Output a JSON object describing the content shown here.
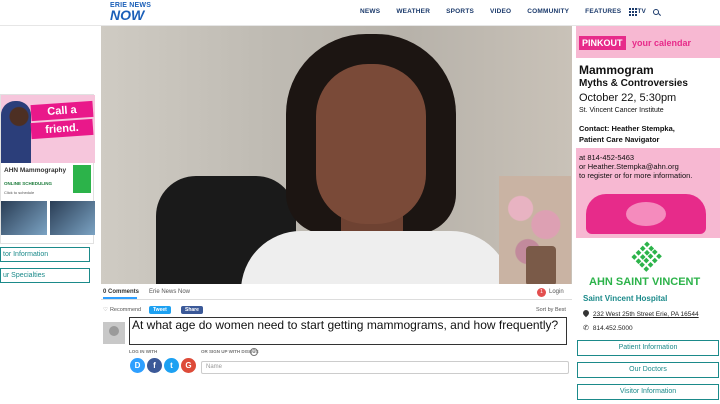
{
  "header": {
    "logo_top": "ERIE NEWS",
    "logo_main": "NOW",
    "nav": [
      "NEWS",
      "WEATHER",
      "SPORTS",
      "VIDEO",
      "COMMUNITY",
      "FEATURES",
      "TV"
    ]
  },
  "left_ad": {
    "line1": "Call a",
    "line2": "friend.",
    "brand": "AHN Mammography",
    "scheduling": "ONLINE SCHEDULING",
    "small": "Click to schedule"
  },
  "left_buttons": [
    "tor Information",
    "ur Specialties"
  ],
  "comments": {
    "count": "0 Comments",
    "site": "Erie News Now",
    "badge": "1",
    "login": "Login",
    "recommend": "Recommend",
    "tweet": "Tweet",
    "share": "Share",
    "sort": "Sort by Best",
    "input_value": "At what age do women need to start getting mammograms, and how frequently?",
    "log_in_with": "LOG IN WITH",
    "or_sign_up": "OR SIGN UP WITH DISQUS",
    "help": "?",
    "name_placeholder": "Name",
    "social": [
      "D",
      "f",
      "t",
      "G"
    ]
  },
  "right_ad": {
    "pinkout": "PINKOUT",
    "calendar": "your calendar",
    "title1": "Mammogram",
    "title2": "Myths & Controversies",
    "date": "October 22, 5:30pm",
    "institute": "St. Vincent Cancer Institute",
    "contact1": "Contact: Heather Stempka,",
    "contact2": "Patient Care Navigator",
    "phone1": "at 814-452-5463",
    "phone2": "or Heather.Stempka@ahn.org",
    "phone3": "to register or for more information."
  },
  "hospital": {
    "brand": "AHN SAINT VINCENT",
    "name": "Saint Vincent Hospital",
    "address": "232 West 25th Street Erie, PA 16544",
    "tel": "814.452.5000",
    "buttons": [
      "Patient Information",
      "Our Doctors",
      "Visitor Information"
    ]
  },
  "colors": {
    "accent_pink": "#e72b8a",
    "ahn_green": "#2cb34a",
    "teal": "#1b8a8a"
  }
}
